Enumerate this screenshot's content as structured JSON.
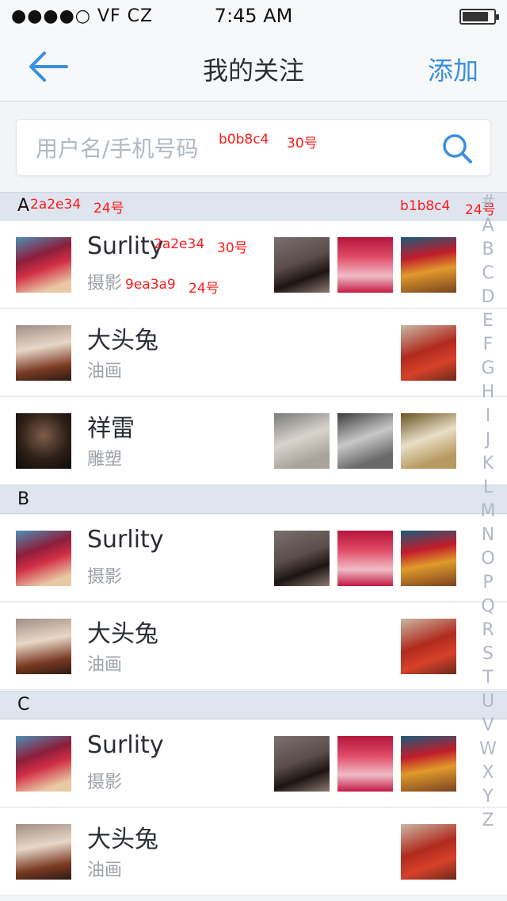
{
  "status": {
    "signal": "●●●●○ VF CZ",
    "time": "7:45 AM"
  },
  "nav": {
    "title": "我的关注",
    "add": "添加"
  },
  "search": {
    "placeholder": "用户名/手机号码"
  },
  "annotations": {
    "search_color": "b0b8c4",
    "search_size": "30号",
    "header_color": "2a2e34",
    "header_size": "24号",
    "index_color": "b1b8c4",
    "index_size": "24号",
    "name_color": "2a2e34",
    "name_size": "30号",
    "tag_color": "9ea3a9",
    "tag_size": "24号"
  },
  "sections": [
    {
      "letter": "A",
      "rows": [
        {
          "name": "Surlity",
          "tag": "摄影",
          "thumbs": [
            "photo",
            "photo",
            "photo"
          ]
        },
        {
          "name": "大头兔",
          "tag": "油画",
          "thumbs": [
            "photo"
          ]
        },
        {
          "name": "祥雷",
          "tag": "雕塑",
          "thumbs": [
            "photo",
            "photo",
            "photo"
          ]
        }
      ]
    },
    {
      "letter": "B",
      "rows": [
        {
          "name": "Surlity",
          "tag": "摄影",
          "thumbs": [
            "photo",
            "photo",
            "photo"
          ]
        },
        {
          "name": "大头兔",
          "tag": "油画",
          "thumbs": [
            "photo"
          ]
        }
      ]
    },
    {
      "letter": "C",
      "rows": [
        {
          "name": "Surlity",
          "tag": "摄影",
          "thumbs": [
            "photo",
            "photo",
            "photo"
          ]
        },
        {
          "name": "大头兔",
          "tag": "油画",
          "thumbs": [
            "photo"
          ]
        }
      ]
    }
  ],
  "index": [
    "#",
    "A",
    "B",
    "C",
    "D",
    "E",
    "F",
    "G",
    "H",
    "I",
    "J",
    "K",
    "L",
    "M",
    "N",
    "O",
    "P",
    "Q",
    "R",
    "S",
    "T",
    "U",
    "V",
    "W",
    "X",
    "Y",
    "Z"
  ],
  "colors": {
    "accent": "#3a8fde",
    "name": "#2a2e34",
    "tag": "#9ea3a9",
    "placeholder": "#b0b8c4",
    "index": "#b1b8c4",
    "header_bg": "#dfe5ee"
  }
}
